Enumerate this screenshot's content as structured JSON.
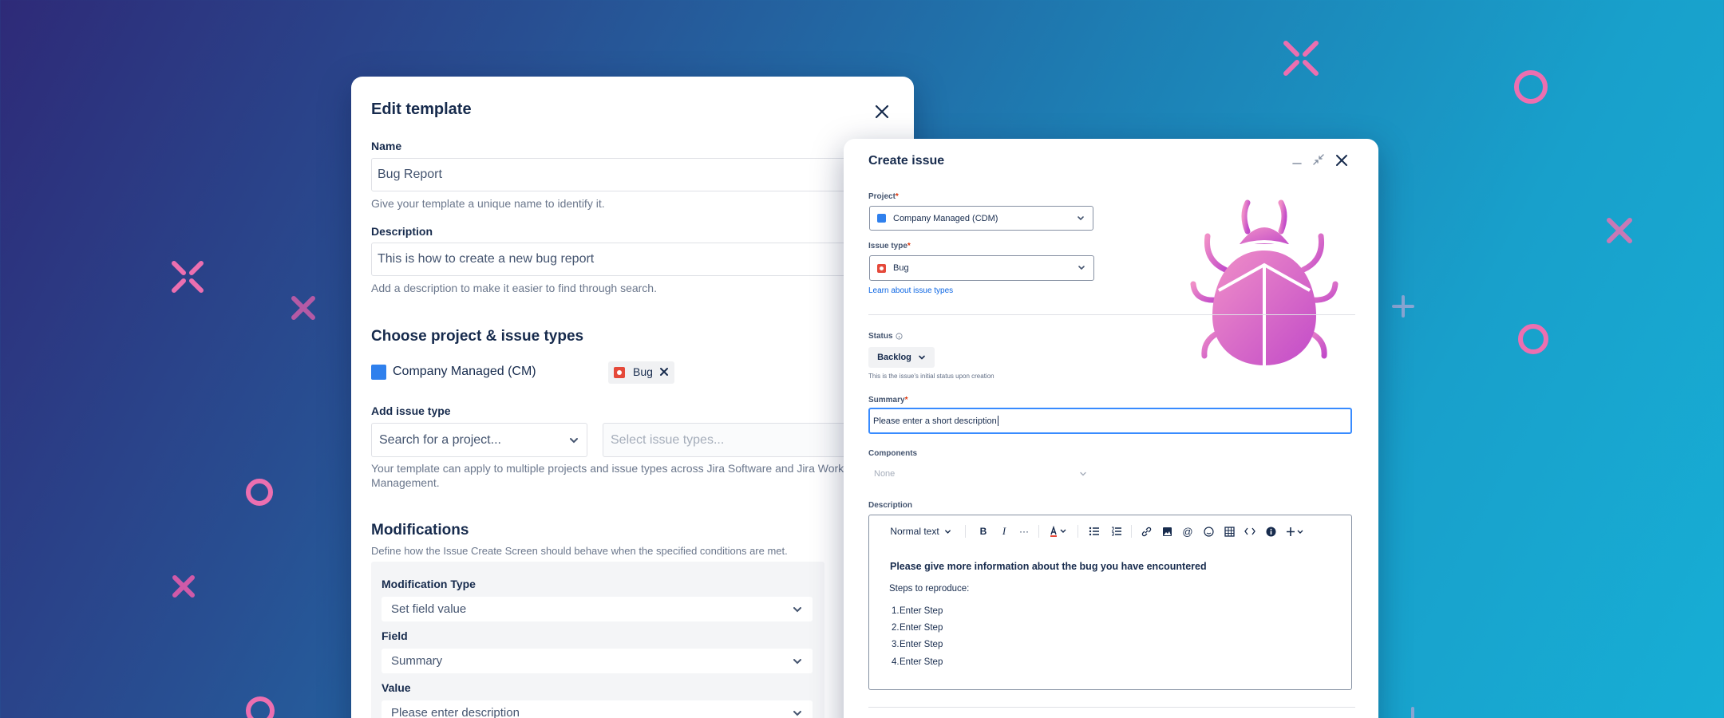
{
  "edit_template": {
    "title": "Edit template",
    "name_label": "Name",
    "name_value": "Bug Report",
    "name_help": "Give your template a unique name to identify it.",
    "description_label": "Description",
    "description_value": "This is how to create a new bug report",
    "description_help": "Add a description to make it easier to find through search.",
    "section_title": "Choose project & issue types",
    "project_name": "Company Managed (CM)",
    "issue_tag": "Bug",
    "add_issue_type_label": "Add issue type",
    "project_search_placeholder": "Search for a project...",
    "issue_types_placeholder": "Select issue types...",
    "apply_help_line1": "Your template can apply to multiple projects and issue types across Jira Software and Jira Work",
    "apply_help_line2": "Management.",
    "modifications_title": "Modifications",
    "modifications_help": "Define how the Issue Create Screen should behave when the specified conditions are met.",
    "modification_type_label": "Modification Type",
    "modification_type_value": "Set field value",
    "field_label": "Field",
    "field_value": "Summary",
    "value_label": "Value",
    "value_placeholder": "Please enter description"
  },
  "create_issue": {
    "title": "Create issue",
    "project_label": "Project",
    "project_value": "Company Managed (CDM)",
    "issue_type_label": "Issue type",
    "issue_type_value": "Bug",
    "learn_link": "Learn about issue types",
    "status_label": "Status",
    "status_value": "Backlog",
    "status_help": "This is the issue's initial status upon creation",
    "summary_label": "Summary",
    "summary_value": "Please enter a short description",
    "components_label": "Components",
    "components_placeholder": "None",
    "description_label": "Description",
    "text_style": "Normal text",
    "editor_heading": "Please give more information about the bug you have encountered",
    "steps_label": "Steps to reproduce:",
    "steps": [
      "Enter Step",
      "Enter Step",
      "Enter Step",
      "Enter Step"
    ],
    "step_numbers": [
      "1.",
      "2.",
      "3.",
      "4."
    ]
  },
  "colors": {
    "accent_pink": "#ec6fb0",
    "project_blue": "#2f80ed",
    "bug_red": "#e5493a",
    "link_blue": "#0c66e4"
  },
  "icons": [
    "close-icon",
    "chevron-down-icon",
    "bug-icon",
    "project-square-icon",
    "minimize-icon",
    "collapse-icon",
    "info-icon",
    "bold-icon",
    "italic-icon",
    "more-icon",
    "text-color-icon",
    "bullet-list-icon",
    "numbered-list-icon",
    "link-icon",
    "image-icon",
    "mention-icon",
    "emoji-icon",
    "table-icon",
    "code-icon",
    "info-panel-icon",
    "plus-icon",
    "beetle-illustration"
  ]
}
